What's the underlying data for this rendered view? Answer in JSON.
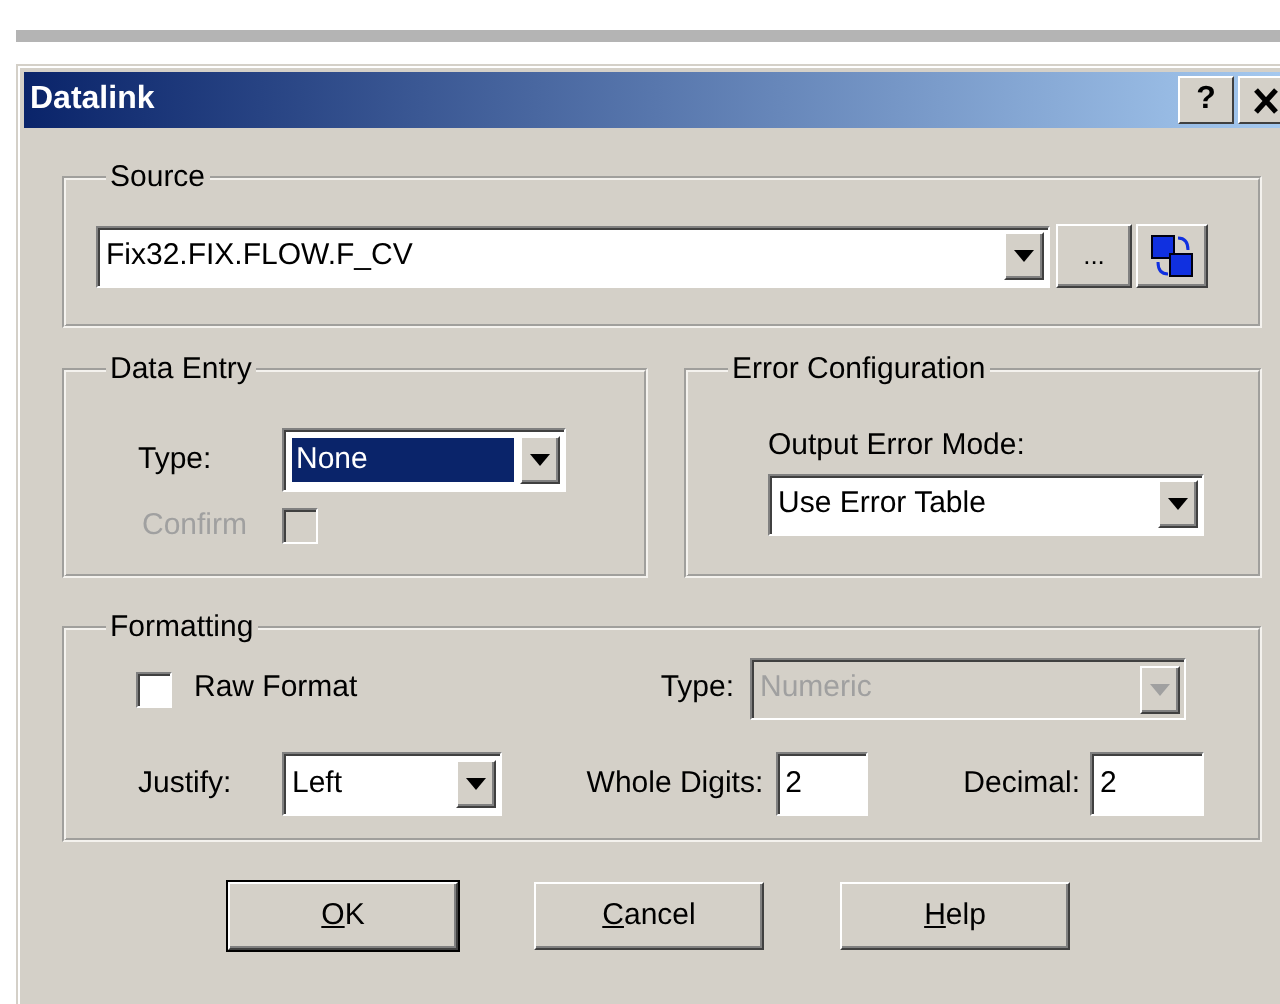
{
  "window": {
    "title": "Datalink",
    "help_label": "?"
  },
  "source": {
    "legend": "Source",
    "value": "Fix32.FIX.FLOW.F_CV",
    "browse_label": "..."
  },
  "data_entry": {
    "legend": "Data Entry",
    "type_label": "Type:",
    "type_value": "None",
    "type_selected": true,
    "confirm_label": "Confirm",
    "confirm_checked": false,
    "confirm_disabled": true
  },
  "error_configuration": {
    "legend": "Error Configuration",
    "mode_label": "Output Error Mode:",
    "mode_value": "Use Error Table"
  },
  "formatting": {
    "legend": "Formatting",
    "raw_format": {
      "label": "Raw Format",
      "checked": false
    },
    "type": {
      "label": "Type:",
      "value": "Numeric",
      "disabled": true
    },
    "justify": {
      "label": "Justify:",
      "value": "Left"
    },
    "whole_digits": {
      "label": "Whole Digits:",
      "value": "2"
    },
    "decimal": {
      "label": "Decimal:",
      "value": "2"
    }
  },
  "buttons": [
    {
      "label": "OK",
      "default": true,
      "underline_first": true
    },
    {
      "label": "Cancel",
      "default": false,
      "underline_first": true
    },
    {
      "label": "Help",
      "default": false,
      "underline_first": true
    }
  ]
}
